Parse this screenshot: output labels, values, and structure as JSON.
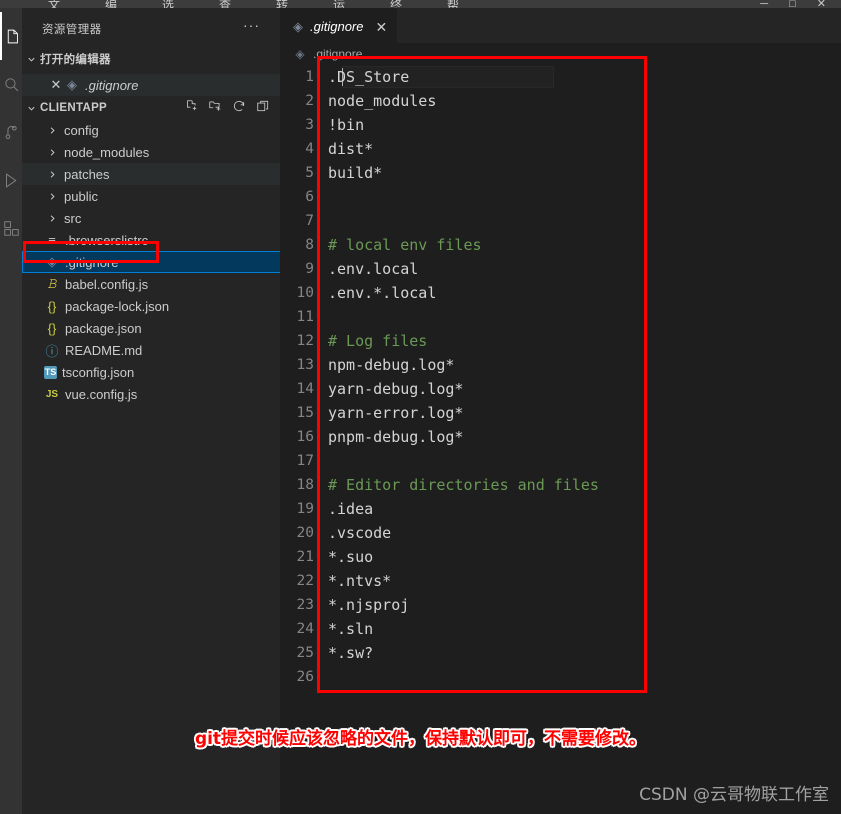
{
  "window": {
    "menu_items": [
      "文件",
      "编辑",
      "选择",
      "查看",
      "转到",
      "运行",
      "终端",
      "帮助"
    ],
    "window_buttons": "─ □ ✕"
  },
  "activity_bar": {
    "items": [
      {
        "name": "explorer-icon",
        "label": "资源管理器"
      },
      {
        "name": "search-icon",
        "label": "搜索"
      },
      {
        "name": "source-control-icon",
        "label": "源代码管理"
      },
      {
        "name": "run-debug-icon",
        "label": "运行和调试"
      },
      {
        "name": "extensions-icon",
        "label": "扩展"
      }
    ]
  },
  "sidebar": {
    "title": "资源管理器",
    "more_actions": "···",
    "open_editors": {
      "label": "打开的编辑器",
      "chevron": "⌄",
      "items": [
        {
          "name": ".gitignore",
          "icon": "git-icon",
          "close": "✕"
        }
      ]
    },
    "project": {
      "label": "CLIENTAPP",
      "chevron": "⌄",
      "actions": [
        "new-file-icon",
        "new-folder-icon",
        "refresh-icon",
        "collapse-all-icon"
      ]
    },
    "tree": [
      {
        "name": "config",
        "type": "folder",
        "chevron": "›",
        "icon": "",
        "icon_color": "#cccccc",
        "selected": false,
        "hover": false
      },
      {
        "name": "node_modules",
        "type": "folder",
        "chevron": "›",
        "icon": "",
        "icon_color": "#cccccc",
        "selected": false,
        "hover": false
      },
      {
        "name": "patches",
        "type": "folder",
        "chevron": "›",
        "icon": "",
        "icon_color": "#cccccc",
        "selected": false,
        "hover": true
      },
      {
        "name": "public",
        "type": "folder",
        "chevron": "›",
        "icon": "",
        "icon_color": "#cccccc",
        "selected": false,
        "hover": false
      },
      {
        "name": "src",
        "type": "folder",
        "chevron": "›",
        "icon": "",
        "icon_color": "#cccccc",
        "selected": false,
        "hover": false
      },
      {
        "name": ".browserslistrc",
        "type": "file",
        "chevron": "",
        "icon": "≡",
        "icon_color": "#cccccc",
        "selected": false,
        "hover": false
      },
      {
        "name": ".gitignore",
        "type": "file",
        "chevron": "",
        "icon": "◈",
        "icon_color": "#7a8596",
        "selected": true,
        "hover": false
      },
      {
        "name": "babel.config.js",
        "type": "file",
        "chevron": "",
        "icon": "𝙱",
        "icon_color": "#f0db4f",
        "selected": false,
        "hover": false
      },
      {
        "name": "package-lock.json",
        "type": "file",
        "chevron": "",
        "icon": "{}",
        "icon_color": "#cbcb41",
        "selected": false,
        "hover": false
      },
      {
        "name": "package.json",
        "type": "file",
        "chevron": "",
        "icon": "{}",
        "icon_color": "#cbcb41",
        "selected": false,
        "hover": false
      },
      {
        "name": "README.md",
        "type": "file",
        "chevron": "",
        "icon": "ⓘ",
        "icon_color": "#519aba",
        "selected": false,
        "hover": false
      },
      {
        "name": "tsconfig.json",
        "type": "file",
        "chevron": "",
        "icon": "TS",
        "icon_color": "#519aba",
        "selected": false,
        "hover": false
      },
      {
        "name": "vue.config.js",
        "type": "file",
        "chevron": "",
        "icon": "JS",
        "icon_color": "#cbcb41",
        "selected": false,
        "hover": false
      }
    ]
  },
  "editor": {
    "tab": {
      "label": ".gitignore",
      "icon": "git-icon",
      "close": "✕"
    },
    "breadcrumb": {
      "icon": "git-icon",
      "text": ".gitignore"
    },
    "active_line": 1,
    "lines": [
      {
        "n": "1",
        "text": ".DS_Store",
        "comment": false
      },
      {
        "n": "2",
        "text": "node_modules",
        "comment": false
      },
      {
        "n": "3",
        "text": "!bin",
        "comment": false
      },
      {
        "n": "4",
        "text": "dist*",
        "comment": false
      },
      {
        "n": "5",
        "text": "build*",
        "comment": false
      },
      {
        "n": "6",
        "text": "",
        "comment": false
      },
      {
        "n": "7",
        "text": "",
        "comment": false
      },
      {
        "n": "8",
        "text": "# local env files",
        "comment": true
      },
      {
        "n": "9",
        "text": ".env.local",
        "comment": false
      },
      {
        "n": "10",
        "text": ".env.*.local",
        "comment": false
      },
      {
        "n": "11",
        "text": "",
        "comment": false
      },
      {
        "n": "12",
        "text": "# Log files",
        "comment": true
      },
      {
        "n": "13",
        "text": "npm-debug.log*",
        "comment": false
      },
      {
        "n": "14",
        "text": "yarn-debug.log*",
        "comment": false
      },
      {
        "n": "15",
        "text": "yarn-error.log*",
        "comment": false
      },
      {
        "n": "16",
        "text": "pnpm-debug.log*",
        "comment": false
      },
      {
        "n": "17",
        "text": "",
        "comment": false
      },
      {
        "n": "18",
        "text": "# Editor directories and files",
        "comment": true
      },
      {
        "n": "19",
        "text": ".idea",
        "comment": false
      },
      {
        "n": "20",
        "text": ".vscode",
        "comment": false
      },
      {
        "n": "21",
        "text": "*.suo",
        "comment": false
      },
      {
        "n": "22",
        "text": "*.ntvs*",
        "comment": false
      },
      {
        "n": "23",
        "text": "*.njsproj",
        "comment": false
      },
      {
        "n": "24",
        "text": "*.sln",
        "comment": false
      },
      {
        "n": "25",
        "text": "*.sw?",
        "comment": false
      },
      {
        "n": "26",
        "text": "",
        "comment": false
      }
    ]
  },
  "annotations": {
    "caption": "git提交时候应该忽略的文件，保持默认即可，不需要修改。",
    "caption_color": "#ff0000",
    "box_color": "#ff0000",
    "watermark": "CSDN @云哥物联工作室"
  },
  "colors": {
    "accent": "#007fd4",
    "selection_bg": "#04395e",
    "editor_bg": "#1e1e1e",
    "sidebar_bg": "#252526",
    "comment_green": "#6a9955",
    "text": "#d4d4d4"
  }
}
